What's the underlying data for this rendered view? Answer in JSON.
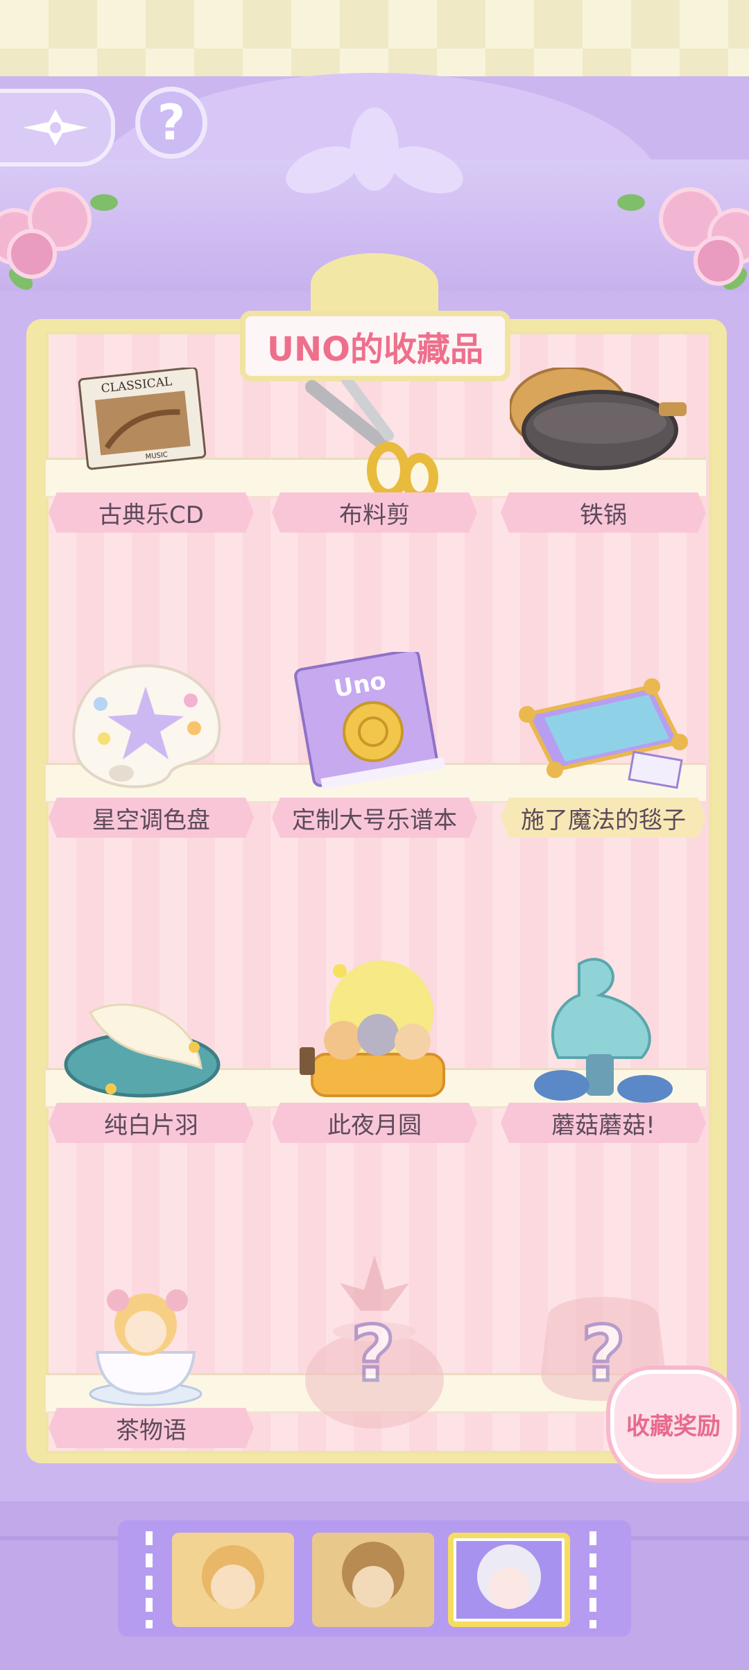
{
  "title": "UNO的收藏品",
  "header": {
    "back_icon": "sparkle-arrow-icon",
    "help_label": "?"
  },
  "shelves": [
    {
      "items": [
        {
          "label": "古典乐CD",
          "icon": "classical-cd-icon",
          "cover_text": "CLASSICAL",
          "cover_sub": "MUSIC"
        },
        {
          "label": "布料剪",
          "icon": "scissors-icon"
        },
        {
          "label": "铁锅",
          "icon": "wok-icon"
        }
      ]
    },
    {
      "items": [
        {
          "label": "星空调色盘",
          "icon": "palette-icon"
        },
        {
          "label": "定制大号乐谱本",
          "icon": "sheet-music-book-icon",
          "cover_text": "Uno"
        },
        {
          "label": "施了魔法的毯子",
          "icon": "magic-carpet-icon",
          "highlight": true
        }
      ]
    },
    {
      "items": [
        {
          "label": "纯白片羽",
          "icon": "feather-cushion-icon"
        },
        {
          "label": "此夜月圆",
          "icon": "moon-cats-icon"
        },
        {
          "label": "蘑菇蘑菇!",
          "icon": "mushroom-icon"
        }
      ]
    },
    {
      "items": [
        {
          "label": "茶物语",
          "icon": "teacup-doll-icon"
        },
        {
          "label": "",
          "icon": "locked-jar-icon",
          "locked_mark": "?"
        },
        {
          "label": "",
          "icon": "locked-item-icon",
          "locked_mark": "?"
        }
      ]
    }
  ],
  "rewards_label": "收藏奖励",
  "characters": [
    {
      "name": "character-1",
      "selected": false
    },
    {
      "name": "character-2",
      "selected": false
    },
    {
      "name": "character-3",
      "selected": true
    }
  ]
}
